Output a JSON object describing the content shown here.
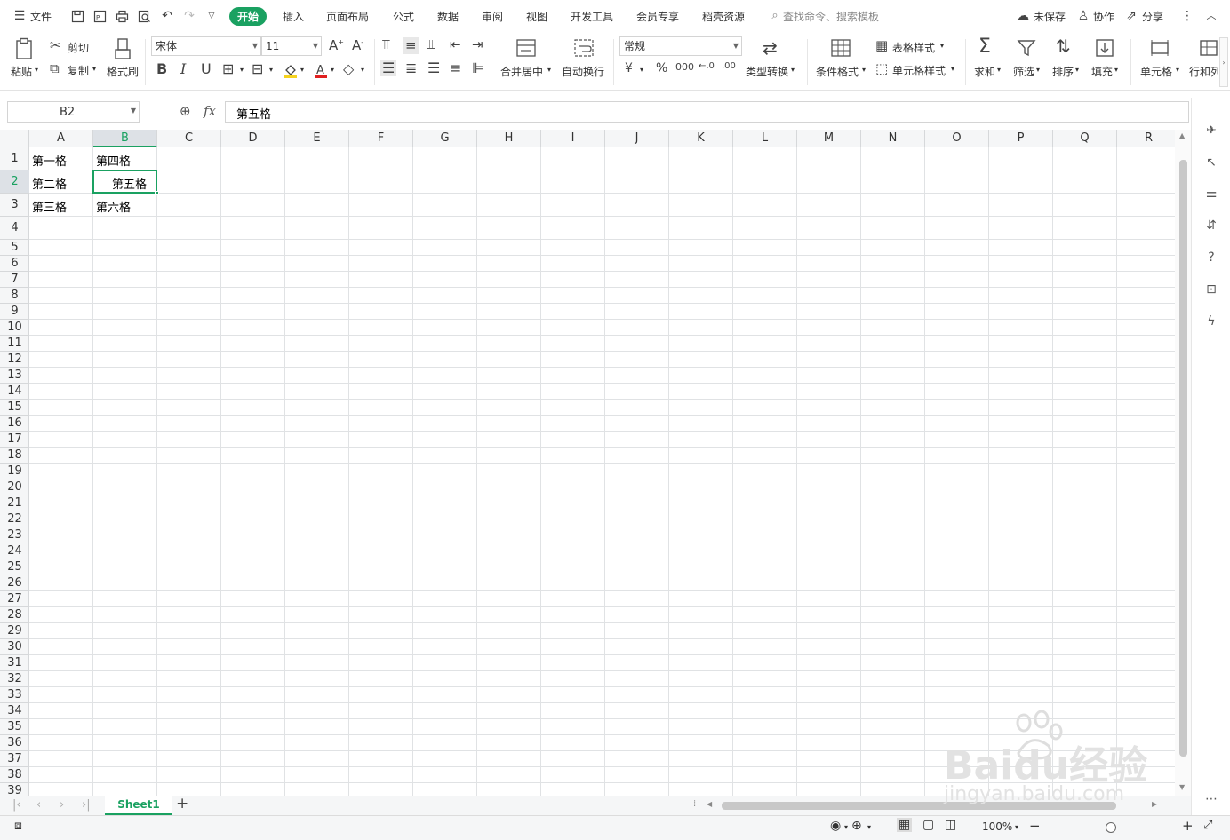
{
  "menubar": {
    "file": "文件",
    "tabs": [
      "开始",
      "插入",
      "页面布局",
      "公式",
      "数据",
      "审阅",
      "视图",
      "开发工具",
      "会员专享",
      "稻壳资源"
    ],
    "search": "查找命令、搜索模板",
    "unsaved": "未保存",
    "collab": "协作",
    "share": "分享"
  },
  "ribbon": {
    "paste": "粘贴",
    "cut": "剪切",
    "copy": "复制",
    "format_painter": "格式刷",
    "font_name": "宋体",
    "font_size": "11",
    "merge_center": "合并居中",
    "wrap": "自动换行",
    "number_format": "常规",
    "type_convert": "类型转换",
    "cond_format": "条件格式",
    "table_style": "表格样式",
    "cell_style": "单元格样式",
    "sum": "求和",
    "filter": "筛选",
    "sort": "排序",
    "fill": "填充",
    "cell": "单元格",
    "row_col": "行和列"
  },
  "formula_bar": {
    "name_box": "B2",
    "fx": "fx",
    "content": "第五格"
  },
  "grid": {
    "columns": [
      "A",
      "B",
      "C",
      "D",
      "E",
      "F",
      "G",
      "H",
      "I",
      "J",
      "K",
      "L",
      "M",
      "N",
      "O",
      "P",
      "Q",
      "R"
    ],
    "rows": [
      "1",
      "2",
      "3",
      "4",
      "5",
      "6",
      "7",
      "8",
      "9",
      "10",
      "11",
      "12",
      "13",
      "14",
      "15",
      "16",
      "17",
      "18",
      "19",
      "20",
      "21",
      "22",
      "23",
      "24",
      "25",
      "26",
      "27",
      "28",
      "29",
      "30",
      "31",
      "32",
      "33",
      "34",
      "35",
      "36",
      "37",
      "38",
      "39"
    ],
    "cells": {
      "A1": "第一格",
      "A2": "第二格",
      "A3": "第三格",
      "B1": "第四格",
      "B2": "第五格",
      "B3": "第六格"
    },
    "selected_cell": "B2",
    "accent": "#1aa161"
  },
  "sheets": {
    "tabs": [
      "Sheet1"
    ],
    "add": "+"
  },
  "status": {
    "zoom": "100%"
  },
  "watermark": {
    "brand": "Baidu经验",
    "url": "jingyan.baidu.com"
  }
}
